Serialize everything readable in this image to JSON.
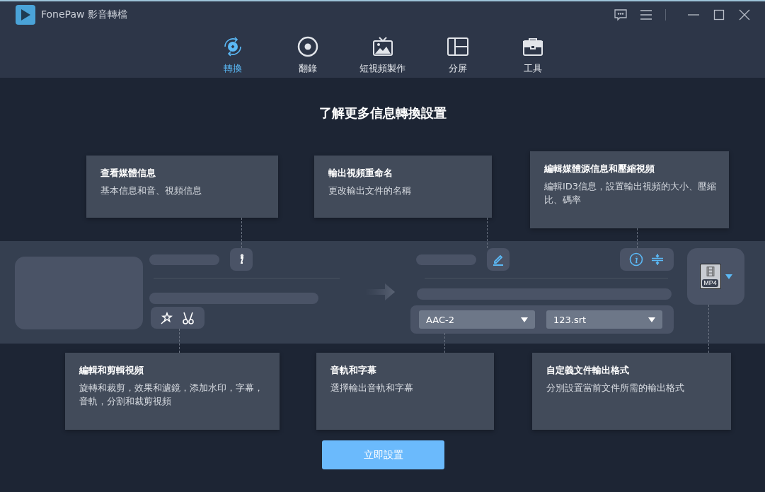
{
  "window": {
    "title": "FonePaw 影音轉檔"
  },
  "tabs": [
    {
      "label": "轉換",
      "selected": true,
      "kind": "convert"
    },
    {
      "label": "翻錄",
      "selected": false,
      "kind": "rip"
    },
    {
      "label": "短視頻製作",
      "selected": false,
      "kind": "mv"
    },
    {
      "label": "分屏",
      "selected": false,
      "kind": "collage"
    },
    {
      "label": "工具",
      "selected": false,
      "kind": "toolbox"
    }
  ],
  "heading": "了解更多信息轉換設置",
  "top_callouts": [
    {
      "title": "查看媒體信息",
      "description": "基本信息和音、視頻信息"
    },
    {
      "title": "輸出視頻重命名",
      "description": "更改輸出文件的名稱"
    },
    {
      "title": "編輯媒體源信息和壓縮視頻",
      "description": "編輯ID3信息，設置輸出視頻的大小、壓縮比、碼率"
    }
  ],
  "file_row": {
    "audio_track": "AAC-2",
    "subtitle": "123.srt",
    "format": "MP4"
  },
  "bottom_callouts": [
    {
      "title": "編輯和剪輯視頻",
      "description": "旋轉和裁剪，效果和濾鏡，添加水印，字幕，音軌，分割和裁剪視頻"
    },
    {
      "title": "音軌和字幕",
      "description": "選擇輸出音軌和字幕"
    },
    {
      "title": "自定義文件輸出格式",
      "description": "分別設置當前文件所需的輸出格式"
    }
  ],
  "button": "立即設置"
}
